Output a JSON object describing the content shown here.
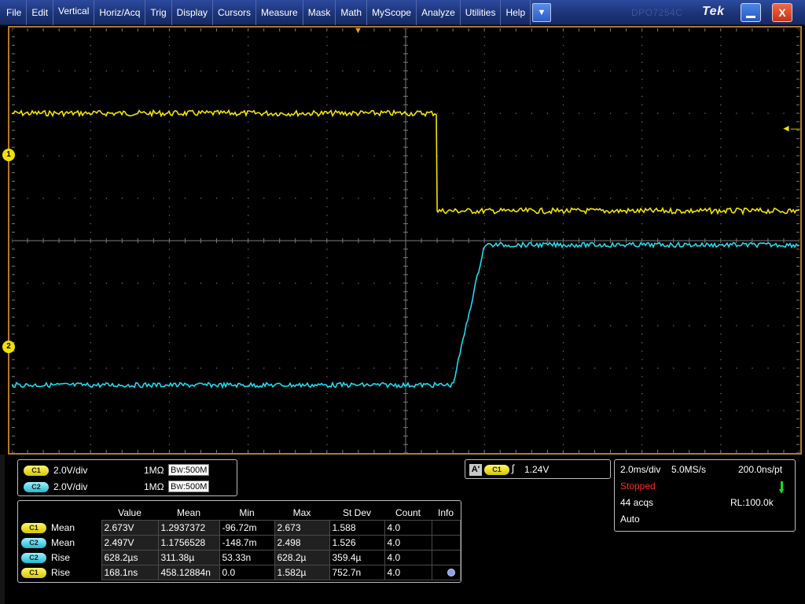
{
  "menubar": {
    "items": [
      "File",
      "Edit",
      "Vertical",
      "Horiz/Acq",
      "Trig",
      "Display",
      "Cursors",
      "Measure",
      "Mask",
      "Math",
      "MyScope",
      "Analyze",
      "Utilities",
      "Help"
    ],
    "dropdown_symbol": "▼",
    "brand_faint": "DPO7254C",
    "brand": "Tek",
    "close_symbol": "X"
  },
  "colors": {
    "ch1": "#f2e400",
    "ch2": "#1fdcf0",
    "grid": "#7a7a7a",
    "frame": "#b07a30"
  },
  "graticule": {
    "ch1_marker": "1",
    "ch2_marker": "2",
    "trigger_position_symbol": "▼",
    "trigger_level_symbol": "◄—"
  },
  "waveforms": {
    "ch1": {
      "low_div": 3.0,
      "high_div": 0.7,
      "edge_div": 5.4
    },
    "ch2": {
      "low_div": -3.4,
      "high_div": -0.1,
      "edge_start_div": 5.6,
      "edge_end_div": 6.0
    }
  },
  "channels": [
    {
      "pill": "C1",
      "scale": "2.0V/div",
      "impedance": "1MΩ",
      "bw_prefix": "B",
      "bw_sub": "W",
      "bw": ":500M"
    },
    {
      "pill": "C2",
      "scale": "2.0V/div",
      "impedance": "1MΩ",
      "bw_prefix": "B",
      "bw_sub": "W",
      "bw": ":500M"
    }
  ],
  "trigger": {
    "badge": "A'",
    "source": "C1",
    "slope_symbol": "ʃ",
    "level": "1.24V"
  },
  "acquisition": {
    "timebase": "2.0ms/div",
    "sample_rate": "5.0MS/s",
    "resolution": "200.0ns/pt",
    "state": "Stopped",
    "acqs": "44 acqs",
    "record_length": "RL:100.0k",
    "mode": "Auto"
  },
  "measurements": {
    "headers": [
      "Value",
      "Mean",
      "Min",
      "Max",
      "St Dev",
      "Count",
      "Info"
    ],
    "rows": [
      {
        "source": "C1",
        "type": "Mean",
        "value": "2.673V",
        "mean": "1.2937372",
        "min": "-96.72m",
        "max": "2.673",
        "stdev": "1.588",
        "count": "4.0",
        "info": ""
      },
      {
        "source": "C2",
        "type": "Mean",
        "value": "2.497V",
        "mean": "1.1756528",
        "min": "-148.7m",
        "max": "2.498",
        "stdev": "1.526",
        "count": "4.0",
        "info": ""
      },
      {
        "source": "C2",
        "type": "Rise",
        "value": "628.2µs",
        "mean": "311.38µ",
        "min": "53.33n",
        "max": "628.2µ",
        "stdev": "359.4µ",
        "count": "4.0",
        "info": ""
      },
      {
        "source": "C1",
        "type": "Rise",
        "value": "168.1ns",
        "mean": "458.12884n",
        "min": "0.0",
        "max": "1.582µ",
        "stdev": "752.7n",
        "count": "4.0",
        "info": "dot"
      }
    ]
  }
}
